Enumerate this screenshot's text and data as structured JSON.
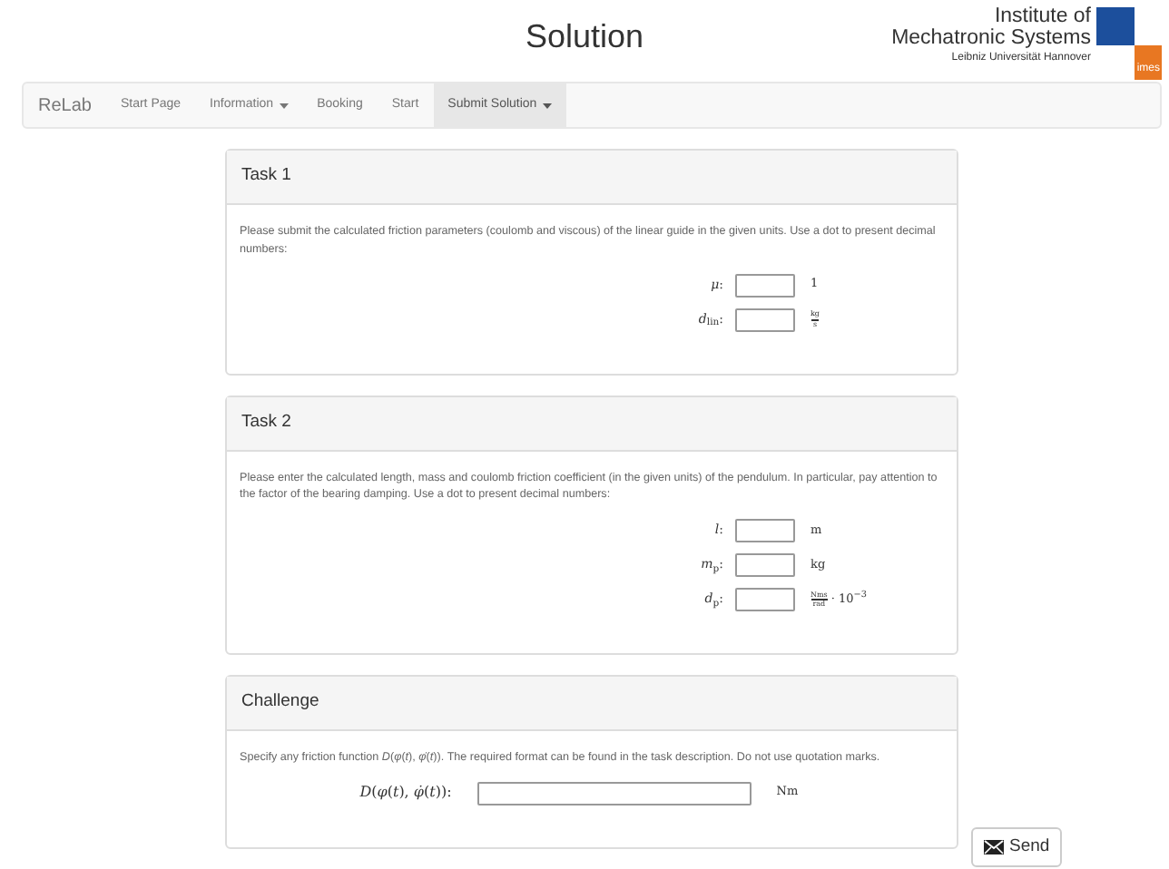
{
  "header": {
    "title": "Solution",
    "logo": {
      "line_1": "Institute of",
      "line_2": "Mechatronic Systems",
      "line_3": "Leibniz Universität Hannover",
      "badge": "imes"
    }
  },
  "navbar": {
    "brand": "ReLab",
    "items": [
      {
        "label": "Start Page",
        "dropdown": false,
        "selected": false
      },
      {
        "label": "Information",
        "dropdown": true,
        "selected": false
      },
      {
        "label": "Booking",
        "dropdown": false,
        "selected": false
      },
      {
        "label": "Start",
        "dropdown": false,
        "selected": false
      },
      {
        "label": "Submit Solution",
        "dropdown": true,
        "selected": true
      }
    ]
  },
  "panels": [
    {
      "title": "Task 1",
      "text": "Please submit the calculated friction parameters (coulomb and viscous) of the linear guide in the given units. Use a dot to present decimal numbers:",
      "fields": [
        {
          "label": "*μ*:",
          "wide": false,
          "unit": {
            "kind": "text",
            "text": "1"
          }
        },
        {
          "label": "*d*$_{lin}$:",
          "wide": false,
          "unit": {
            "kind": "fraction",
            "num": "kg",
            "den": "s"
          }
        }
      ]
    },
    {
      "title": "Task 2",
      "text": "Please enter the calculated length, mass and coulomb friction coefficient (in the given units) of the pendulum. In particular, pay attention to the factor of the bearing damping. Use a dot to present decimal numbers:",
      "fields": [
        {
          "label": "*l*:",
          "wide": false,
          "unit": {
            "kind": "text",
            "text": "m"
          }
        },
        {
          "label": "*m*$_{p}$:",
          "wide": false,
          "unit": {
            "kind": "text",
            "text": "kg"
          }
        },
        {
          "label": "*d*$_{p}$:",
          "wide": false,
          "unit": {
            "kind": "fraction",
            "num": "Nms",
            "den": "rad",
            "suffix": "· 10$^{−3}$"
          }
        }
      ]
    },
    {
      "title": "Challenge",
      "text": "Specify any friction function *D*(*φ*(*t*), *φ̇*(*t*)). The required format can be found in the task description. Do not use quotation marks.",
      "fields": [
        {
          "label": "*D*(*φ*(*t*), *φ̇*(*t*)):",
          "wide": true,
          "unit": {
            "kind": "text",
            "text": "Nm"
          }
        }
      ]
    }
  ],
  "send_button": {
    "label": "Send"
  }
}
